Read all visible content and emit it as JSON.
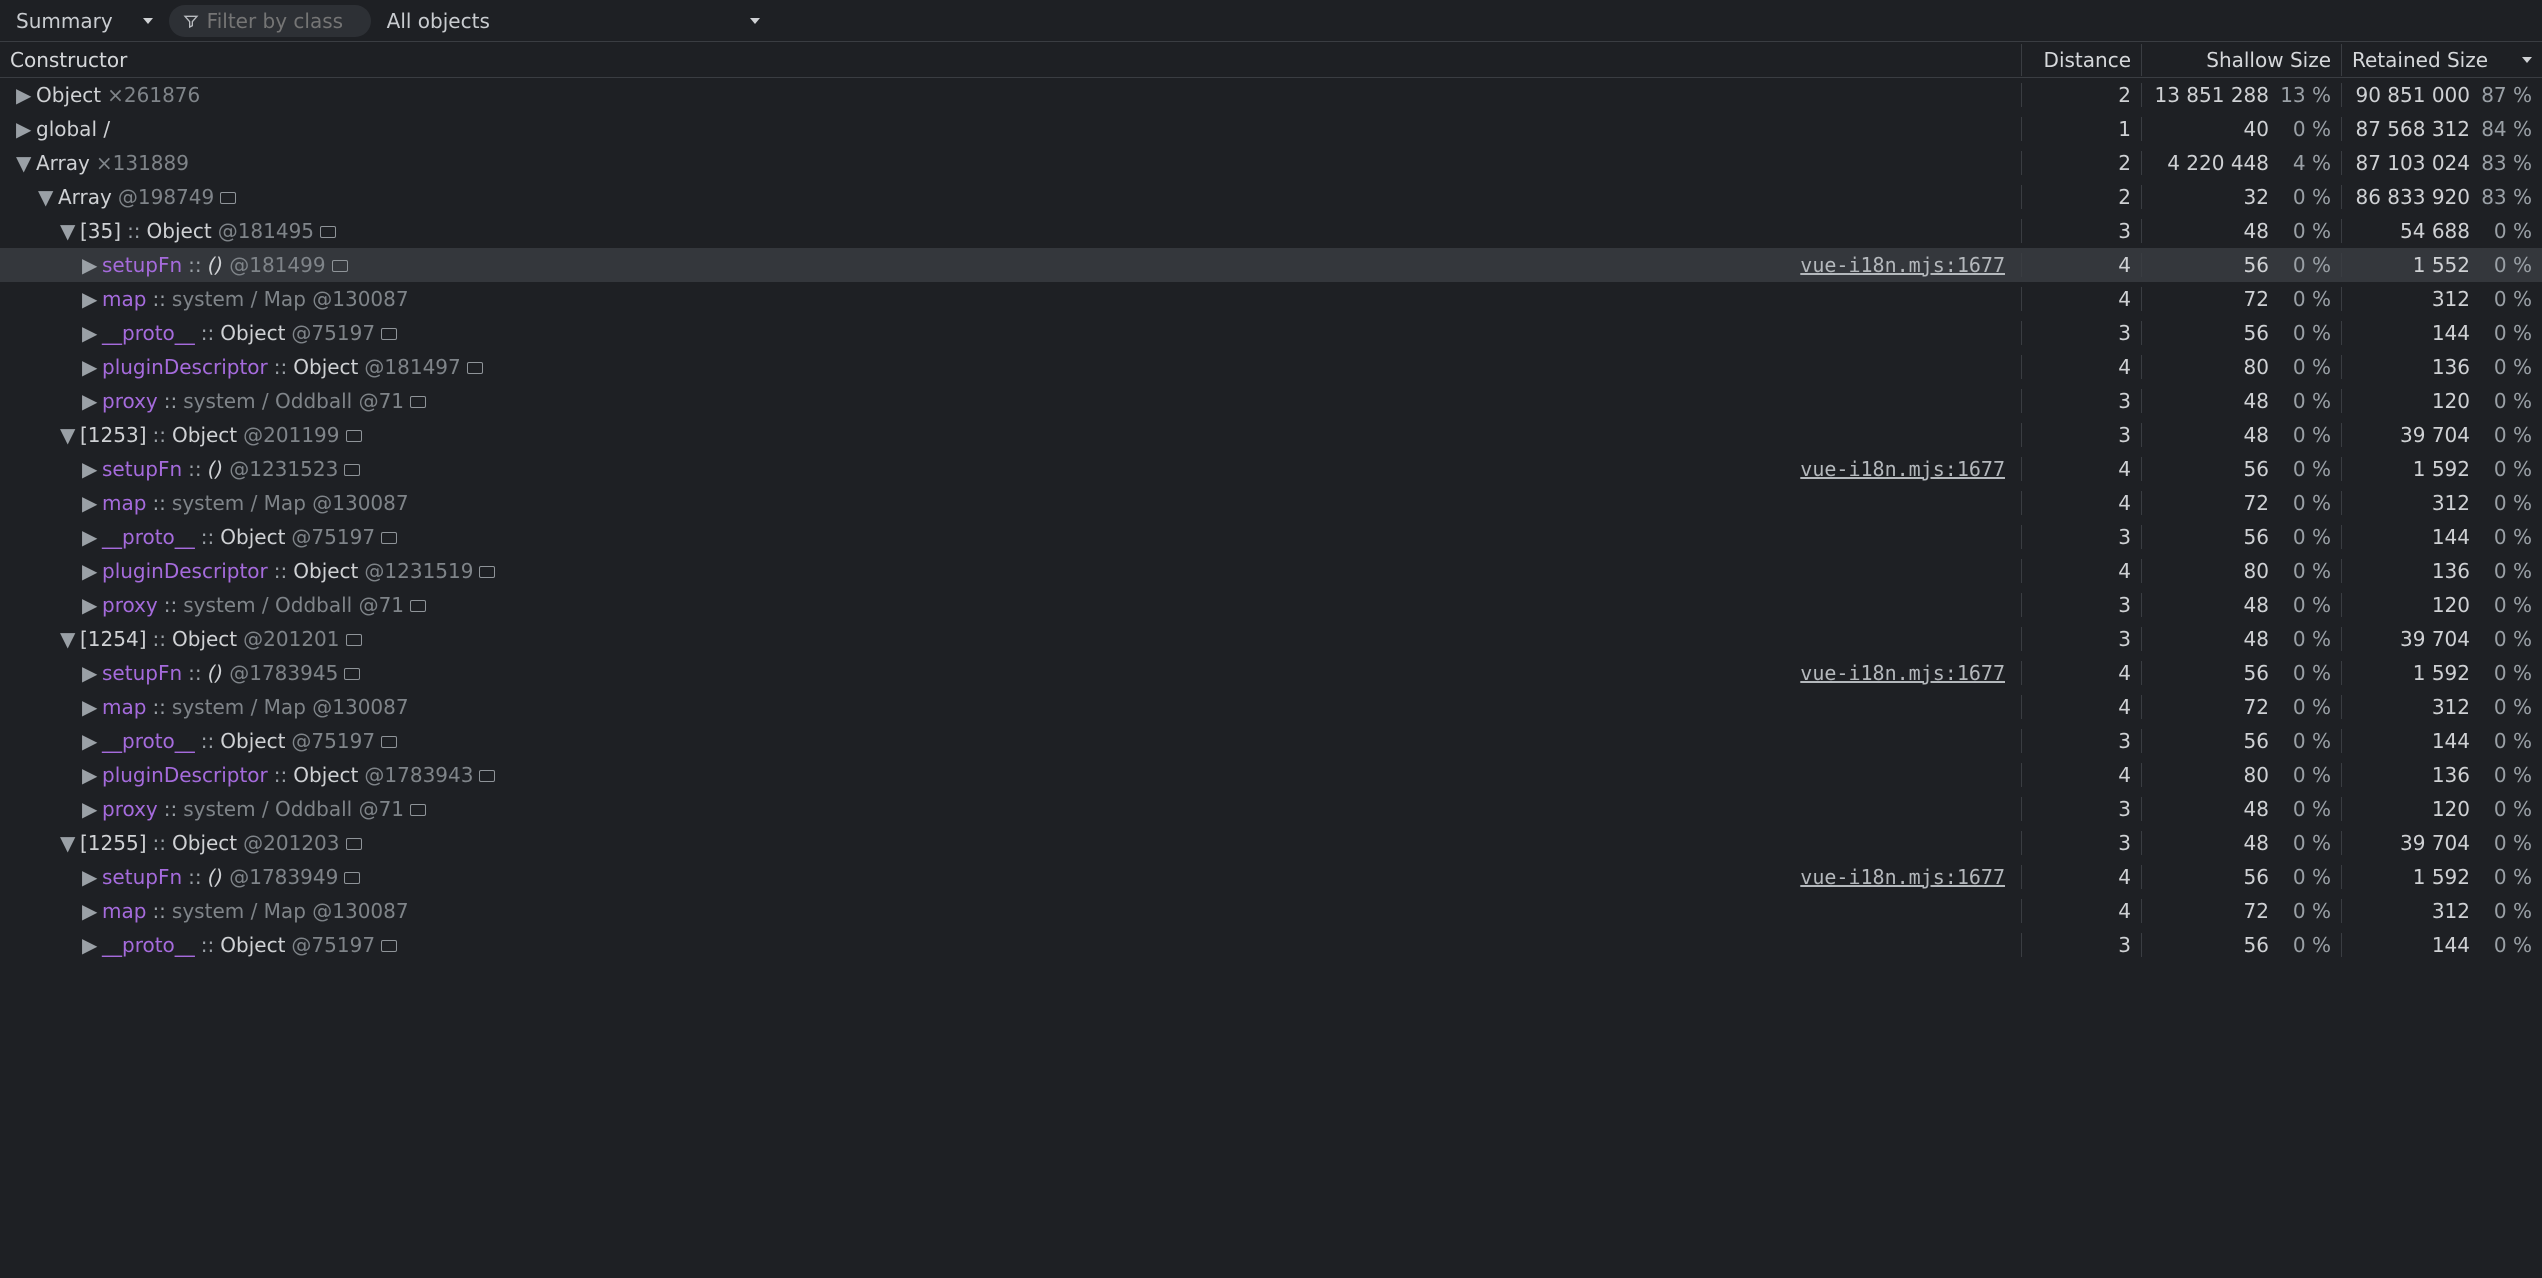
{
  "toolbar": {
    "view_mode": "Summary",
    "filter_placeholder": "Filter by class",
    "scope": "All objects"
  },
  "columns": {
    "constructor": "Constructor",
    "distance": "Distance",
    "shallow": "Shallow Size",
    "retained": "Retained Size"
  },
  "source_link": "vue-i18n.mjs:1677",
  "rows": [
    {
      "d": 0,
      "tw": "▶",
      "segs": [
        [
          "typ",
          "Object"
        ],
        [
          "sp",
          " "
        ],
        [
          "dim",
          "×261876"
        ]
      ],
      "dist": "2",
      "sh": "13 851 288",
      "shp": "13 %",
      "re": "90 851 000",
      "rep": "87 %"
    },
    {
      "d": 0,
      "tw": "▶",
      "segs": [
        [
          "typ",
          "global /"
        ]
      ],
      "dist": "1",
      "sh": "40",
      "shp": "0 %",
      "re": "87 568 312",
      "rep": "84 %"
    },
    {
      "d": 0,
      "tw": "▼",
      "segs": [
        [
          "typ",
          "Array"
        ],
        [
          "sp",
          " "
        ],
        [
          "dim",
          "×131889"
        ]
      ],
      "dist": "2",
      "sh": "4 220 448",
      "shp": "4 %",
      "re": "87 103 024",
      "rep": "83 %"
    },
    {
      "d": 1,
      "tw": "▼",
      "segs": [
        [
          "typ",
          "Array"
        ],
        [
          "sp",
          " "
        ],
        [
          "dim",
          "@198749"
        ],
        [
          "sp",
          " "
        ],
        [
          "icon",
          ""
        ]
      ],
      "dist": "2",
      "sh": "32",
      "shp": "0 %",
      "re": "86 833 920",
      "rep": "83 %"
    },
    {
      "d": 2,
      "tw": "▼",
      "segs": [
        [
          "bracket",
          "[35]"
        ],
        [
          "sp",
          " "
        ],
        [
          "sep",
          "::"
        ],
        [
          "sp",
          " "
        ],
        [
          "typ",
          "Object"
        ],
        [
          "sp",
          " "
        ],
        [
          "dim",
          "@181495"
        ],
        [
          "sp",
          " "
        ],
        [
          "icon",
          ""
        ]
      ],
      "dist": "3",
      "sh": "48",
      "shp": "0 %",
      "re": "54 688",
      "rep": "0 %"
    },
    {
      "d": 3,
      "tw": "▶",
      "sel": true,
      "link": true,
      "segs": [
        [
          "prop",
          "setupFn"
        ],
        [
          "sp",
          " "
        ],
        [
          "sep",
          "::"
        ],
        [
          "sp",
          " "
        ],
        [
          "parens",
          "()"
        ],
        [
          "sp",
          " "
        ],
        [
          "dim",
          "@181499"
        ],
        [
          "sp",
          " "
        ],
        [
          "icon",
          ""
        ]
      ],
      "dist": "4",
      "sh": "56",
      "shp": "0 %",
      "re": "1 552",
      "rep": "0 %"
    },
    {
      "d": 3,
      "tw": "▶",
      "segs": [
        [
          "prop",
          "map"
        ],
        [
          "sp",
          " "
        ],
        [
          "sep",
          "::"
        ],
        [
          "sp",
          " "
        ],
        [
          "dim",
          "system / Map @130087"
        ]
      ],
      "dist": "4",
      "sh": "72",
      "shp": "0 %",
      "re": "312",
      "rep": "0 %"
    },
    {
      "d": 3,
      "tw": "▶",
      "segs": [
        [
          "prop",
          "__proto__"
        ],
        [
          "sp",
          " "
        ],
        [
          "sep",
          "::"
        ],
        [
          "sp",
          " "
        ],
        [
          "typ",
          "Object"
        ],
        [
          "sp",
          " "
        ],
        [
          "dim",
          "@75197"
        ],
        [
          "sp",
          " "
        ],
        [
          "icon",
          ""
        ]
      ],
      "dist": "3",
      "sh": "56",
      "shp": "0 %",
      "re": "144",
      "rep": "0 %"
    },
    {
      "d": 3,
      "tw": "▶",
      "segs": [
        [
          "prop",
          "pluginDescriptor"
        ],
        [
          "sp",
          " "
        ],
        [
          "sep",
          "::"
        ],
        [
          "sp",
          " "
        ],
        [
          "typ",
          "Object"
        ],
        [
          "sp",
          " "
        ],
        [
          "dim",
          "@181497"
        ],
        [
          "sp",
          " "
        ],
        [
          "icon",
          ""
        ]
      ],
      "dist": "4",
      "sh": "80",
      "shp": "0 %",
      "re": "136",
      "rep": "0 %"
    },
    {
      "d": 3,
      "tw": "▶",
      "segs": [
        [
          "prop",
          "proxy"
        ],
        [
          "sp",
          " "
        ],
        [
          "sep",
          "::"
        ],
        [
          "sp",
          " "
        ],
        [
          "dim",
          "system / Oddball @71"
        ],
        [
          "sp",
          " "
        ],
        [
          "icon",
          ""
        ]
      ],
      "dist": "3",
      "sh": "48",
      "shp": "0 %",
      "re": "120",
      "rep": "0 %"
    },
    {
      "d": 2,
      "tw": "▼",
      "segs": [
        [
          "bracket",
          "[1253]"
        ],
        [
          "sp",
          " "
        ],
        [
          "sep",
          "::"
        ],
        [
          "sp",
          " "
        ],
        [
          "typ",
          "Object"
        ],
        [
          "sp",
          " "
        ],
        [
          "dim",
          "@201199"
        ],
        [
          "sp",
          " "
        ],
        [
          "icon",
          ""
        ]
      ],
      "dist": "3",
      "sh": "48",
      "shp": "0 %",
      "re": "39 704",
      "rep": "0 %"
    },
    {
      "d": 3,
      "tw": "▶",
      "link": true,
      "segs": [
        [
          "prop",
          "setupFn"
        ],
        [
          "sp",
          " "
        ],
        [
          "sep",
          "::"
        ],
        [
          "sp",
          " "
        ],
        [
          "parens",
          "()"
        ],
        [
          "sp",
          " "
        ],
        [
          "dim",
          "@1231523"
        ],
        [
          "sp",
          " "
        ],
        [
          "icon",
          ""
        ]
      ],
      "dist": "4",
      "sh": "56",
      "shp": "0 %",
      "re": "1 592",
      "rep": "0 %"
    },
    {
      "d": 3,
      "tw": "▶",
      "segs": [
        [
          "prop",
          "map"
        ],
        [
          "sp",
          " "
        ],
        [
          "sep",
          "::"
        ],
        [
          "sp",
          " "
        ],
        [
          "dim",
          "system / Map @130087"
        ]
      ],
      "dist": "4",
      "sh": "72",
      "shp": "0 %",
      "re": "312",
      "rep": "0 %"
    },
    {
      "d": 3,
      "tw": "▶",
      "segs": [
        [
          "prop",
          "__proto__"
        ],
        [
          "sp",
          " "
        ],
        [
          "sep",
          "::"
        ],
        [
          "sp",
          " "
        ],
        [
          "typ",
          "Object"
        ],
        [
          "sp",
          " "
        ],
        [
          "dim",
          "@75197"
        ],
        [
          "sp",
          " "
        ],
        [
          "icon",
          ""
        ]
      ],
      "dist": "3",
      "sh": "56",
      "shp": "0 %",
      "re": "144",
      "rep": "0 %"
    },
    {
      "d": 3,
      "tw": "▶",
      "segs": [
        [
          "prop",
          "pluginDescriptor"
        ],
        [
          "sp",
          " "
        ],
        [
          "sep",
          "::"
        ],
        [
          "sp",
          " "
        ],
        [
          "typ",
          "Object"
        ],
        [
          "sp",
          " "
        ],
        [
          "dim",
          "@1231519"
        ],
        [
          "sp",
          " "
        ],
        [
          "icon",
          ""
        ]
      ],
      "dist": "4",
      "sh": "80",
      "shp": "0 %",
      "re": "136",
      "rep": "0 %"
    },
    {
      "d": 3,
      "tw": "▶",
      "segs": [
        [
          "prop",
          "proxy"
        ],
        [
          "sp",
          " "
        ],
        [
          "sep",
          "::"
        ],
        [
          "sp",
          " "
        ],
        [
          "dim",
          "system / Oddball @71"
        ],
        [
          "sp",
          " "
        ],
        [
          "icon",
          ""
        ]
      ],
      "dist": "3",
      "sh": "48",
      "shp": "0 %",
      "re": "120",
      "rep": "0 %"
    },
    {
      "d": 2,
      "tw": "▼",
      "segs": [
        [
          "bracket",
          "[1254]"
        ],
        [
          "sp",
          " "
        ],
        [
          "sep",
          "::"
        ],
        [
          "sp",
          " "
        ],
        [
          "typ",
          "Object"
        ],
        [
          "sp",
          " "
        ],
        [
          "dim",
          "@201201"
        ],
        [
          "sp",
          " "
        ],
        [
          "icon",
          ""
        ]
      ],
      "dist": "3",
      "sh": "48",
      "shp": "0 %",
      "re": "39 704",
      "rep": "0 %"
    },
    {
      "d": 3,
      "tw": "▶",
      "link": true,
      "segs": [
        [
          "prop",
          "setupFn"
        ],
        [
          "sp",
          " "
        ],
        [
          "sep",
          "::"
        ],
        [
          "sp",
          " "
        ],
        [
          "parens",
          "()"
        ],
        [
          "sp",
          " "
        ],
        [
          "dim",
          "@1783945"
        ],
        [
          "sp",
          " "
        ],
        [
          "icon",
          ""
        ]
      ],
      "dist": "4",
      "sh": "56",
      "shp": "0 %",
      "re": "1 592",
      "rep": "0 %"
    },
    {
      "d": 3,
      "tw": "▶",
      "segs": [
        [
          "prop",
          "map"
        ],
        [
          "sp",
          " "
        ],
        [
          "sep",
          "::"
        ],
        [
          "sp",
          " "
        ],
        [
          "dim",
          "system / Map @130087"
        ]
      ],
      "dist": "4",
      "sh": "72",
      "shp": "0 %",
      "re": "312",
      "rep": "0 %"
    },
    {
      "d": 3,
      "tw": "▶",
      "segs": [
        [
          "prop",
          "__proto__"
        ],
        [
          "sp",
          " "
        ],
        [
          "sep",
          "::"
        ],
        [
          "sp",
          " "
        ],
        [
          "typ",
          "Object"
        ],
        [
          "sp",
          " "
        ],
        [
          "dim",
          "@75197"
        ],
        [
          "sp",
          " "
        ],
        [
          "icon",
          ""
        ]
      ],
      "dist": "3",
      "sh": "56",
      "shp": "0 %",
      "re": "144",
      "rep": "0 %"
    },
    {
      "d": 3,
      "tw": "▶",
      "segs": [
        [
          "prop",
          "pluginDescriptor"
        ],
        [
          "sp",
          " "
        ],
        [
          "sep",
          "::"
        ],
        [
          "sp",
          " "
        ],
        [
          "typ",
          "Object"
        ],
        [
          "sp",
          " "
        ],
        [
          "dim",
          "@1783943"
        ],
        [
          "sp",
          " "
        ],
        [
          "icon",
          ""
        ]
      ],
      "dist": "4",
      "sh": "80",
      "shp": "0 %",
      "re": "136",
      "rep": "0 %"
    },
    {
      "d": 3,
      "tw": "▶",
      "segs": [
        [
          "prop",
          "proxy"
        ],
        [
          "sp",
          " "
        ],
        [
          "sep",
          "::"
        ],
        [
          "sp",
          " "
        ],
        [
          "dim",
          "system / Oddball @71"
        ],
        [
          "sp",
          " "
        ],
        [
          "icon",
          ""
        ]
      ],
      "dist": "3",
      "sh": "48",
      "shp": "0 %",
      "re": "120",
      "rep": "0 %"
    },
    {
      "d": 2,
      "tw": "▼",
      "segs": [
        [
          "bracket",
          "[1255]"
        ],
        [
          "sp",
          " "
        ],
        [
          "sep",
          "::"
        ],
        [
          "sp",
          " "
        ],
        [
          "typ",
          "Object"
        ],
        [
          "sp",
          " "
        ],
        [
          "dim",
          "@201203"
        ],
        [
          "sp",
          " "
        ],
        [
          "icon",
          ""
        ]
      ],
      "dist": "3",
      "sh": "48",
      "shp": "0 %",
      "re": "39 704",
      "rep": "0 %"
    },
    {
      "d": 3,
      "tw": "▶",
      "link": true,
      "segs": [
        [
          "prop",
          "setupFn"
        ],
        [
          "sp",
          " "
        ],
        [
          "sep",
          "::"
        ],
        [
          "sp",
          " "
        ],
        [
          "parens",
          "()"
        ],
        [
          "sp",
          " "
        ],
        [
          "dim",
          "@1783949"
        ],
        [
          "sp",
          " "
        ],
        [
          "icon",
          ""
        ]
      ],
      "dist": "4",
      "sh": "56",
      "shp": "0 %",
      "re": "1 592",
      "rep": "0 %"
    },
    {
      "d": 3,
      "tw": "▶",
      "segs": [
        [
          "prop",
          "map"
        ],
        [
          "sp",
          " "
        ],
        [
          "sep",
          "::"
        ],
        [
          "sp",
          " "
        ],
        [
          "dim",
          "system / Map @130087"
        ]
      ],
      "dist": "4",
      "sh": "72",
      "shp": "0 %",
      "re": "312",
      "rep": "0 %"
    },
    {
      "d": 3,
      "tw": "▶",
      "segs": [
        [
          "prop",
          "__proto__"
        ],
        [
          "sp",
          " "
        ],
        [
          "sep",
          "::"
        ],
        [
          "sp",
          " "
        ],
        [
          "typ",
          "Object"
        ],
        [
          "sp",
          " "
        ],
        [
          "dim",
          "@75197"
        ],
        [
          "sp",
          " "
        ],
        [
          "icon",
          ""
        ]
      ],
      "dist": "3",
      "sh": "56",
      "shp": "0 %",
      "re": "144",
      "rep": "0 %"
    }
  ]
}
